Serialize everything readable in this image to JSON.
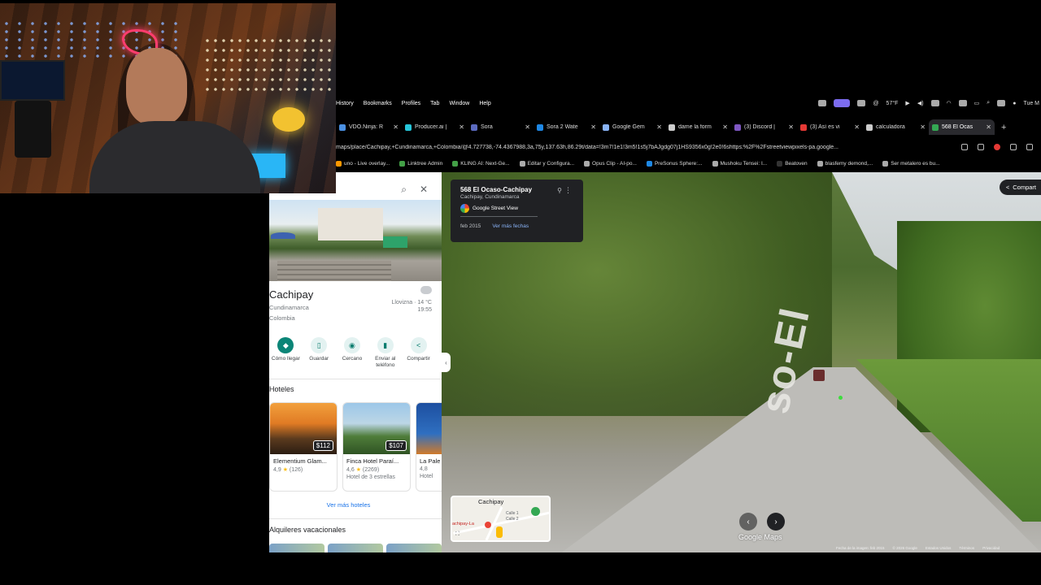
{
  "menubar": {
    "items": [
      "History",
      "Bookmarks",
      "Profiles",
      "Tab",
      "Window",
      "Help"
    ],
    "weather": "57°F",
    "clock": "Tue M"
  },
  "tabs": [
    {
      "title": "VDO.Ninja: R",
      "color": "#4a90e2"
    },
    {
      "title": "Producer.ai |",
      "color": "#26c6da"
    },
    {
      "title": "Sora",
      "color": "#5c6bc0"
    },
    {
      "title": "Sora 2 Wate",
      "color": "#1e88e5"
    },
    {
      "title": "Google Gem",
      "color": "#8ab4f8"
    },
    {
      "title": "dame la form",
      "color": "#cccccc"
    },
    {
      "title": "(3) Discord |",
      "color": "#7e57c2"
    },
    {
      "title": "(3) Así es vi",
      "color": "#e53935"
    },
    {
      "title": "calculadora",
      "color": "#cccccc"
    },
    {
      "title": "568 El Ocas",
      "color": "#34a853"
    }
  ],
  "url": "maps/place/Cachipay,+Cundinamarca,+Colombia/@4.727738,-74.4367988,3a,75y,137.63h,86.29t/data=!3m7!1e1!3m5!1s5j7bAJgdg07j1HS9356x0g!2e0!6shttps:%2F%2Fstreetviewpixels-pa.google...",
  "bookmarks": [
    {
      "label": "uno - Live overlay...",
      "color": "#ff9800"
    },
    {
      "label": "Linktree Admin",
      "color": "#43a047"
    },
    {
      "label": "KLING AI: Next-Ge...",
      "color": "#43a047"
    },
    {
      "label": "Editar y Configura...",
      "color": "#aaaaaa"
    },
    {
      "label": "Opus Clip - AI-po...",
      "color": "#aaaaaa"
    },
    {
      "label": "PreSonus Sphere:...",
      "color": "#1e88e5"
    },
    {
      "label": "Mushoku Tensei: I...",
      "color": "#aaaaaa"
    },
    {
      "label": "Beatoven",
      "color": "#333333"
    },
    {
      "label": "blasfemy demond,...",
      "color": "#aaaaaa"
    },
    {
      "label": "Ser metalero es bu...",
      "color": "#aaaaaa"
    }
  ],
  "place": {
    "title": "Cachipay",
    "line1": "Cundinamarca",
    "line2": "Colombia",
    "weather_desc": "Llovizna · 14 °C",
    "weather_time": "19:55"
  },
  "actions": [
    {
      "label": "Cómo llegar",
      "glyph": "◆"
    },
    {
      "label": "Guardar",
      "glyph": "▯"
    },
    {
      "label": "Cercano",
      "glyph": "◉"
    },
    {
      "label": "Enviar al teléfono",
      "glyph": "▮"
    },
    {
      "label": "Compartir",
      "glyph": "<"
    }
  ],
  "hotels": {
    "title": "Hoteles",
    "items": [
      {
        "name": "Elementium Glam...",
        "rating": "4,9",
        "reviews": "(126)",
        "price": "$112",
        "type": ""
      },
      {
        "name": "Finca Hotel Paraí...",
        "rating": "4,6",
        "reviews": "(2269)",
        "price": "$107",
        "type": "Hotel de 3 estrellas"
      },
      {
        "name": "La Pale",
        "rating": "4,8",
        "reviews": "",
        "price": "",
        "type": "Hotel"
      }
    ],
    "more": "Ver más hoteles"
  },
  "vacation_title": "Alquileres vacacionales",
  "streetview": {
    "title": "568 El Ocaso-Cachipay",
    "subtitle": "Cachipay, Cundinamarca",
    "brand": "Google Street View",
    "date": "feb 2015",
    "more_dates": "Ver más fechas",
    "share": "Compart",
    "road_text": "so-El",
    "minimap_label": "Cachipay",
    "minimap_street1": "Calle 1",
    "minimap_street2": "Calle 2",
    "minimap_place": "achipay-La",
    "logo": "Google Maps",
    "footer": [
      "Fecha de la imagen: feb 2015",
      "© 2026 Google",
      "Estados Unidos",
      "Términos",
      "Privacidad"
    ]
  }
}
